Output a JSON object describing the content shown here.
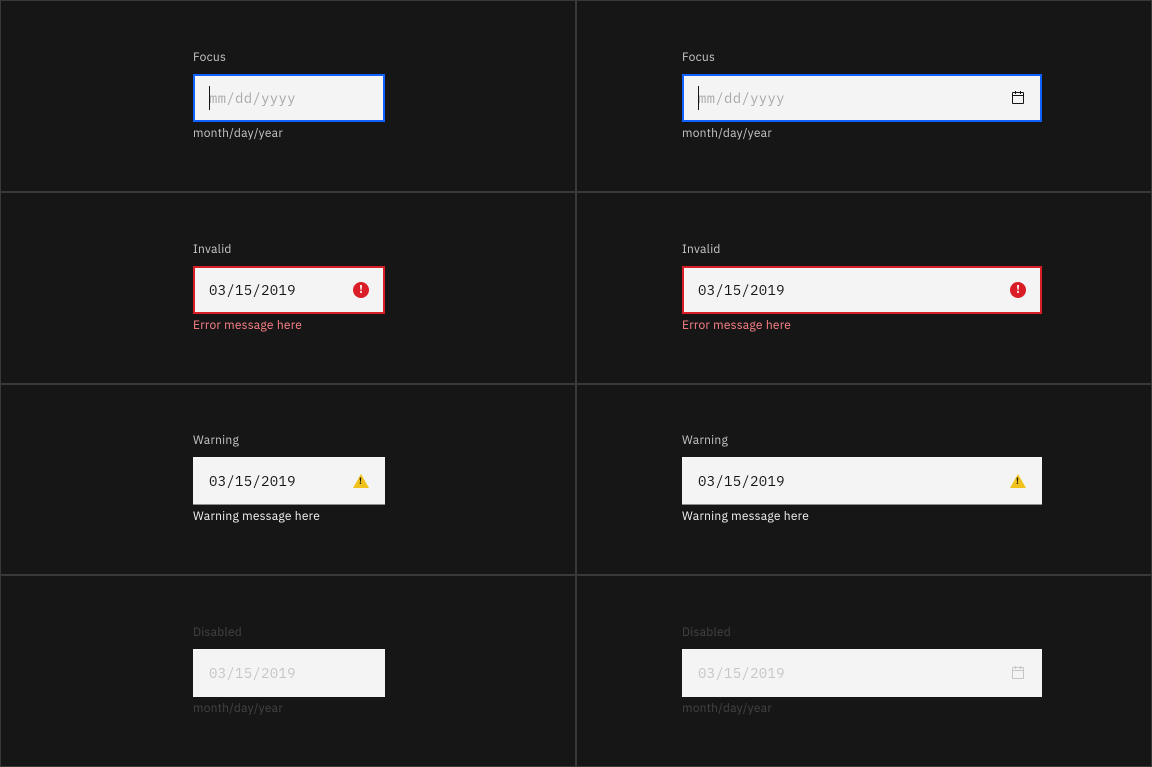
{
  "rows": [
    {
      "label": "Focus",
      "placeholder": "mm/dd/yyyy",
      "value": "",
      "helper": "month/day/year"
    },
    {
      "label": "Invalid",
      "value": "03/15/2019",
      "helper": "Error message here"
    },
    {
      "label": "Warning",
      "value": "03/15/2019",
      "helper": "Warning message here"
    },
    {
      "label": "Disabled",
      "value": "03/15/2019",
      "helper": "month/day/year"
    }
  ]
}
